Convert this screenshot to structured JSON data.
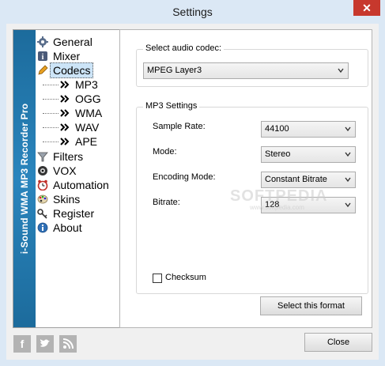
{
  "window": {
    "title": "Settings",
    "close_glyph": "✕"
  },
  "sidebar": {
    "vertical_title": "i-Sound WMA MP3 Recorder Pro",
    "items": [
      {
        "label": "General",
        "icon": "gear-icon"
      },
      {
        "label": "Mixer",
        "icon": "info-icon"
      },
      {
        "label": "Codecs",
        "icon": "pencil-icon",
        "selected": true
      },
      {
        "label": "MP3",
        "icon": "double-arrow-icon",
        "child": true
      },
      {
        "label": "OGG",
        "icon": "double-arrow-icon",
        "child": true
      },
      {
        "label": "WMA",
        "icon": "double-arrow-icon",
        "child": true
      },
      {
        "label": "WAV",
        "icon": "double-arrow-icon",
        "child": true
      },
      {
        "label": "APE",
        "icon": "double-arrow-icon",
        "child": true
      },
      {
        "label": "Filters",
        "icon": "funnel-icon"
      },
      {
        "label": "VOX",
        "icon": "eye-icon"
      },
      {
        "label": "Automation",
        "icon": "clock-icon"
      },
      {
        "label": "Skins",
        "icon": "palette-icon"
      },
      {
        "label": "Register",
        "icon": "key-icon"
      },
      {
        "label": "About",
        "icon": "about-icon"
      }
    ]
  },
  "codec_group": {
    "title": "Select audio codec:",
    "value": "MPEG Layer3"
  },
  "mp3_group": {
    "title": "MP3 Settings",
    "sample_rate_label": "Sample Rate:",
    "sample_rate_value": "44100",
    "mode_label": "Mode:",
    "mode_value": "Stereo",
    "encoding_label": "Encoding Mode:",
    "encoding_value": "Constant Bitrate",
    "bitrate_label": "Bitrate:",
    "bitrate_value": "128",
    "checksum_label": "Checksum",
    "checksum_checked": false
  },
  "buttons": {
    "select_format": "Select this format",
    "close": "Close"
  },
  "social": {
    "facebook": "f",
    "twitter": "t",
    "rss": "rss"
  },
  "watermark": {
    "main": "SOFTPEDIA",
    "sub": "www.softpedia.com"
  },
  "colors": {
    "sidebar_band": "#1c6b9c",
    "selection": "#cce4f7",
    "close_button": "#c7382d"
  }
}
